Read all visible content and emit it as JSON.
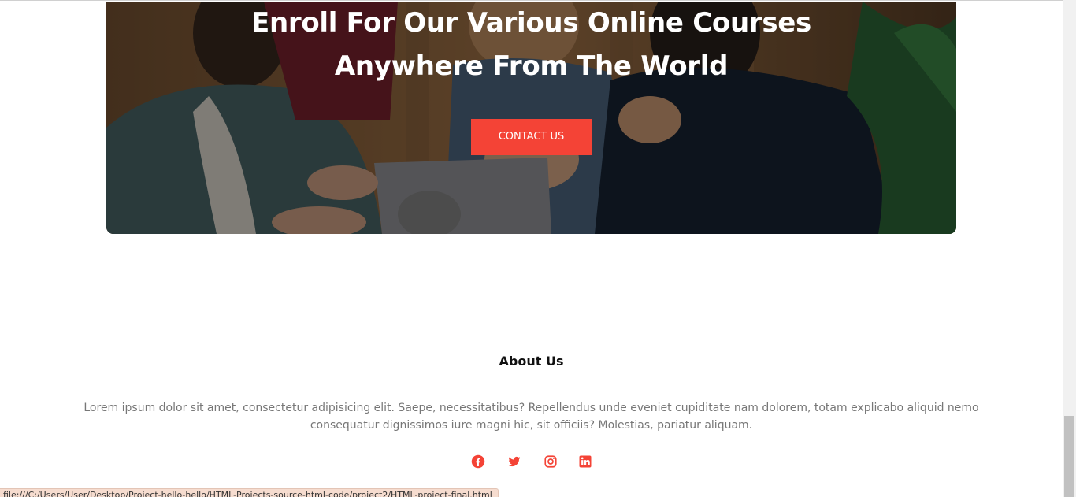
{
  "hero": {
    "title_line1": "Enroll For Our Various Online Courses",
    "title_line2": "Anywhere From The World",
    "cta_label": "CONTACT US"
  },
  "about": {
    "title": "About Us",
    "text": "Lorem ipsum dolor sit amet, consectetur adipisicing elit. Saepe, necessitatibus? Repellendus unde eveniet cupiditate nam dolorem, totam explicabo aliquid nemo consequatur dignissimos iure magni hic, sit officiis? Molestias, pariatur aliquam."
  },
  "socials": [
    {
      "name": "facebook-icon"
    },
    {
      "name": "twitter-icon"
    },
    {
      "name": "instagram-icon"
    },
    {
      "name": "linkedin-icon"
    }
  ],
  "statusbar": {
    "url": "file:///C:/Users/User/Desktop/Project-hello-hello/HTML-Projects-source-html-code/project2/HTML-project-final.html"
  },
  "colors": {
    "accent": "#f44336",
    "text_muted": "#777777",
    "heading": "#111111"
  }
}
